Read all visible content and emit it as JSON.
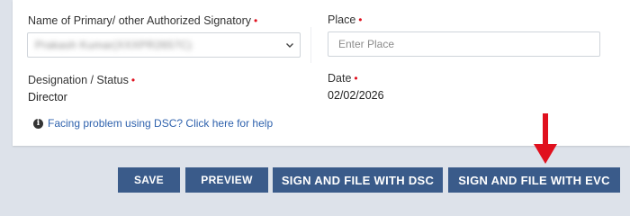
{
  "form": {
    "signatory_label": "Name of Primary/ other Authorized Signatory",
    "signatory_value": "Prakash Kumar(XXXPR2657C)",
    "place_label": "Place",
    "place_value": "",
    "place_placeholder": "Enter Place",
    "designation_label": "Designation / Status",
    "designation_value": "Director",
    "date_label": "Date",
    "date_value": "02/02/2026",
    "required_marker": "•",
    "help_link": "Facing problem using DSC? Click here for help",
    "help_icon": "info-circle-icon"
  },
  "actions": {
    "save_label": "SAVE",
    "preview_label": "PREVIEW",
    "sign_dsc_label": "SIGN AND FILE WITH DSC",
    "sign_evc_label": "SIGN AND FILE WITH EVC"
  },
  "annotation": {
    "arrow_icon": "red-down-arrow-icon",
    "arrow_color": "#e0101e"
  },
  "colors": {
    "button_bg": "#3a5b8a",
    "required": "#e0101e",
    "link": "#2f62ad",
    "page_bg": "#dde2ea"
  }
}
